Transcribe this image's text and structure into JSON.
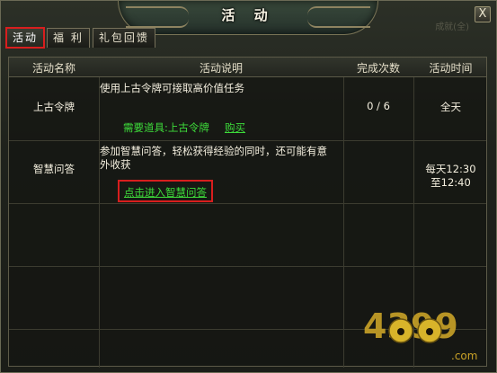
{
  "window": {
    "title": "活 动",
    "close_label": "X",
    "faded_top_right": "成就(全)"
  },
  "tabs": [
    {
      "label": "活动",
      "active": true
    },
    {
      "label": "福 利",
      "active": false
    },
    {
      "label": "礼包回馈",
      "active": false
    }
  ],
  "table": {
    "headers": {
      "name": "活动名称",
      "desc": "活动说明",
      "count": "完成次数",
      "time": "活动时间"
    },
    "rows": [
      {
        "name": "上古令牌",
        "desc": "使用上古令牌可接取高价值任务",
        "required_item_label": "需要道具:上古令牌",
        "buy_link": "购买",
        "count": "0 / 6",
        "time": "全天"
      },
      {
        "name": "智慧问答",
        "desc_line1": "参加智慧问答，轻松获得经验的同时，还可能有意",
        "desc_line2": "外收获",
        "enter_link": "点击进入智慧问答",
        "count": "",
        "time_line1": "每天12:30",
        "time_line2": "至12:40"
      }
    ]
  },
  "watermark": {
    "brand": "4399",
    "suffix": ".com"
  },
  "colors": {
    "highlight_red": "#d81e1e",
    "link_green": "#3ddb3a",
    "text_light": "#f4efdf"
  }
}
